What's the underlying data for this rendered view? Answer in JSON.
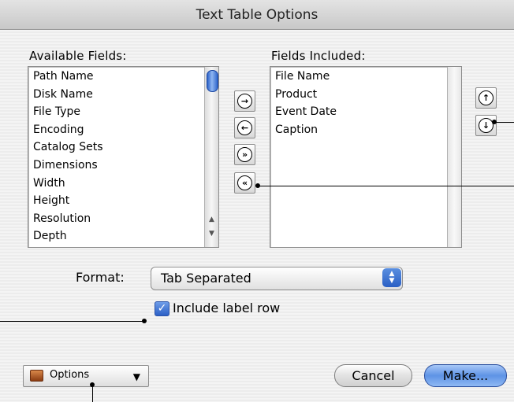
{
  "dialog": {
    "title": "Text Table Options"
  },
  "available": {
    "label": "Available Fields:",
    "items": [
      "Path Name",
      "Disk Name",
      "File Type",
      "Encoding",
      "Catalog Sets",
      "Dimensions",
      "Width",
      "Height",
      "Resolution",
      "Depth"
    ]
  },
  "included": {
    "label": "Fields Included:",
    "items": [
      "File Name",
      "Product",
      "Event Date",
      "Caption"
    ]
  },
  "transfer_buttons": {
    "add": "→",
    "remove": "←",
    "add_all": "»",
    "remove_all": "«"
  },
  "order_buttons": {
    "up": "↑",
    "down": "↓"
  },
  "format": {
    "label": "Format:",
    "value": "Tab Separated"
  },
  "include_label_row": {
    "label": "Include label row",
    "checked": true
  },
  "options_menu": {
    "label": "Options",
    "icon": "briefcase-icon"
  },
  "buttons": {
    "cancel": "Cancel",
    "make": "Make..."
  },
  "colors": {
    "accent": "#3b74d9",
    "check": "#2c60c6"
  }
}
